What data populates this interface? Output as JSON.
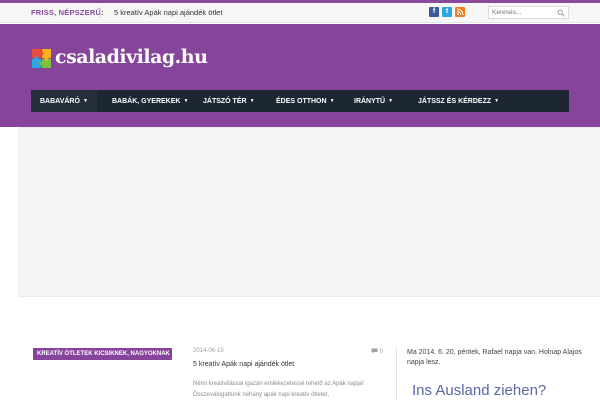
{
  "topbar": {
    "hot_label": "FRISS, NÉPSZERŰ:",
    "hot_link": "5 kreatív Apák napi ajándék ötlet",
    "social": [
      {
        "icon": "facebook-icon",
        "glyph": "f",
        "color": "#3b5998"
      },
      {
        "icon": "twitter-icon",
        "glyph": "t",
        "color": "#2ea7e0"
      },
      {
        "icon": "rss-icon",
        "glyph": "≈",
        "color": "#f57e20"
      }
    ],
    "search_placeholder": "Keresés..."
  },
  "header": {
    "logo_text": "csaladivilag.hu",
    "accent": "#86449a"
  },
  "nav": {
    "items": [
      {
        "label": "BABAVÁRÓ"
      },
      {
        "label": "BABÁK, GYEREKEK"
      },
      {
        "label": "JÁTSZÓ TÉR"
      },
      {
        "label": "ÉDES OTTHON"
      },
      {
        "label": "IRÁNYTŰ"
      },
      {
        "label": "JÁTSSZ ÉS KÉRDEZZ"
      }
    ]
  },
  "content": {
    "category_badge": "KREATÍV ÖTLETEK KICSIKNEK, NAGYOKNAK",
    "post": {
      "date": "2014-06-15",
      "comments": "0",
      "title": "5 kreatív Apák napi ajándék ötlet",
      "excerpt": "Némi kreativitással igazán emlékezetessé tehető az Apák napja! Összeválogattunk néhány apák napi kreatív ötletet,"
    }
  },
  "sidebar": {
    "nameday": "Ma 2014. 6. 20, péntek, Rafael napja van. Holnap Alajos napja lesz.",
    "ad_heading": "Ins Ausland ziehen?"
  }
}
